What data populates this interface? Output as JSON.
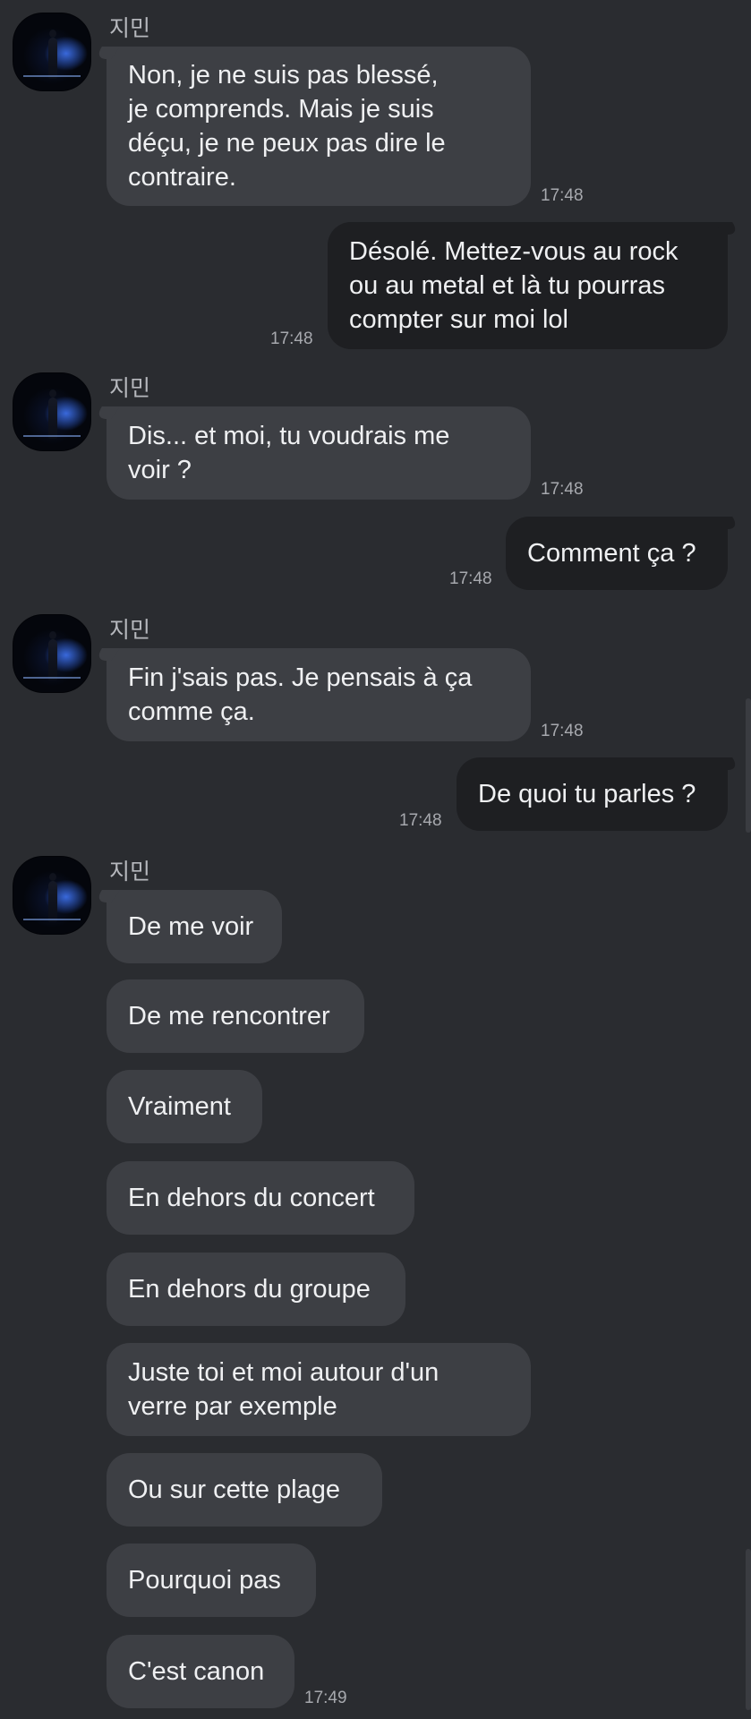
{
  "contact": {
    "name": "지민"
  },
  "messages": [
    {
      "text": "Non, je ne suis pas blessé,\nje comprends. Mais je suis\ndéçu, je ne peux pas dire le\ncontraire.",
      "time": "17:48"
    },
    {
      "text": "Désolé. Mettez-vous au rock\nou au metal et là tu pourras\ncompter sur moi lol",
      "time": "17:48"
    },
    {
      "text": "Dis... et moi, tu voudrais me\nvoir ?",
      "time": "17:48"
    },
    {
      "text": "Comment ça ?",
      "time": "17:48"
    },
    {
      "text": "Fin j'sais pas. Je pensais à ça\ncomme ça.",
      "time": "17:48"
    },
    {
      "text": "De quoi tu parles ?",
      "time": "17:48"
    },
    {
      "text": "De me voir"
    },
    {
      "text": "De me rencontrer"
    },
    {
      "text": "Vraiment"
    },
    {
      "text": "En dehors du concert"
    },
    {
      "text": "En dehors du groupe"
    },
    {
      "text": "Juste toi et moi autour d'un\nverre par exemple"
    },
    {
      "text": "Ou sur cette plage"
    },
    {
      "text": "Pourquoi pas"
    },
    {
      "text": "C'est canon",
      "time": "17:49"
    }
  ],
  "colors": {
    "background": "#2a2c30",
    "incoming_bubble": "#3d3f44",
    "outgoing_bubble": "#1e1f22",
    "text": "#eff0f2",
    "timestamp": "#a7a9ae"
  }
}
